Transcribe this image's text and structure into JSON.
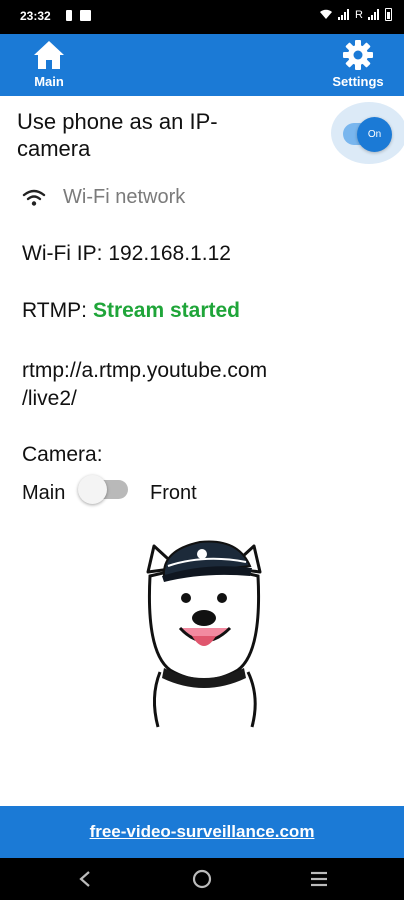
{
  "status_bar": {
    "time": "23:32",
    "carrier_text": "R",
    "icons": [
      "sd-card-icon",
      "square-notification-icon",
      "wifi-status-icon",
      "signal-icon",
      "roaming-signal-icon",
      "battery-icon"
    ]
  },
  "app_bar": {
    "background_color": "#1b7ad6",
    "tabs": [
      {
        "label": "Main",
        "icon": "home-icon"
      },
      {
        "label": "Settings",
        "icon": "gear-icon"
      }
    ]
  },
  "ip_camera": {
    "title": "Use phone as an IP-camera",
    "switch_state": "On",
    "switch_color": "#1b7ad6"
  },
  "network": {
    "icon": "wifi-icon",
    "label": "Wi-Fi network",
    "ip_text": "Wi-Fi IP: 192.168.1.12"
  },
  "rtmp": {
    "label": "RTMP:",
    "status": "Stream started",
    "status_color": "#1fa539",
    "url": "rtmp://a.rtmp.youtube.com /live2/"
  },
  "camera": {
    "label": "Camera:",
    "option_left": "Main",
    "option_right": "Front",
    "switch_on": false
  },
  "mascot": {
    "icon": "dog-captain-mascot"
  },
  "footer": {
    "link_text": "free-video-surveillance.com"
  },
  "system_nav": {
    "icons": [
      "back-icon",
      "home-circle-icon",
      "recents-icon"
    ]
  }
}
